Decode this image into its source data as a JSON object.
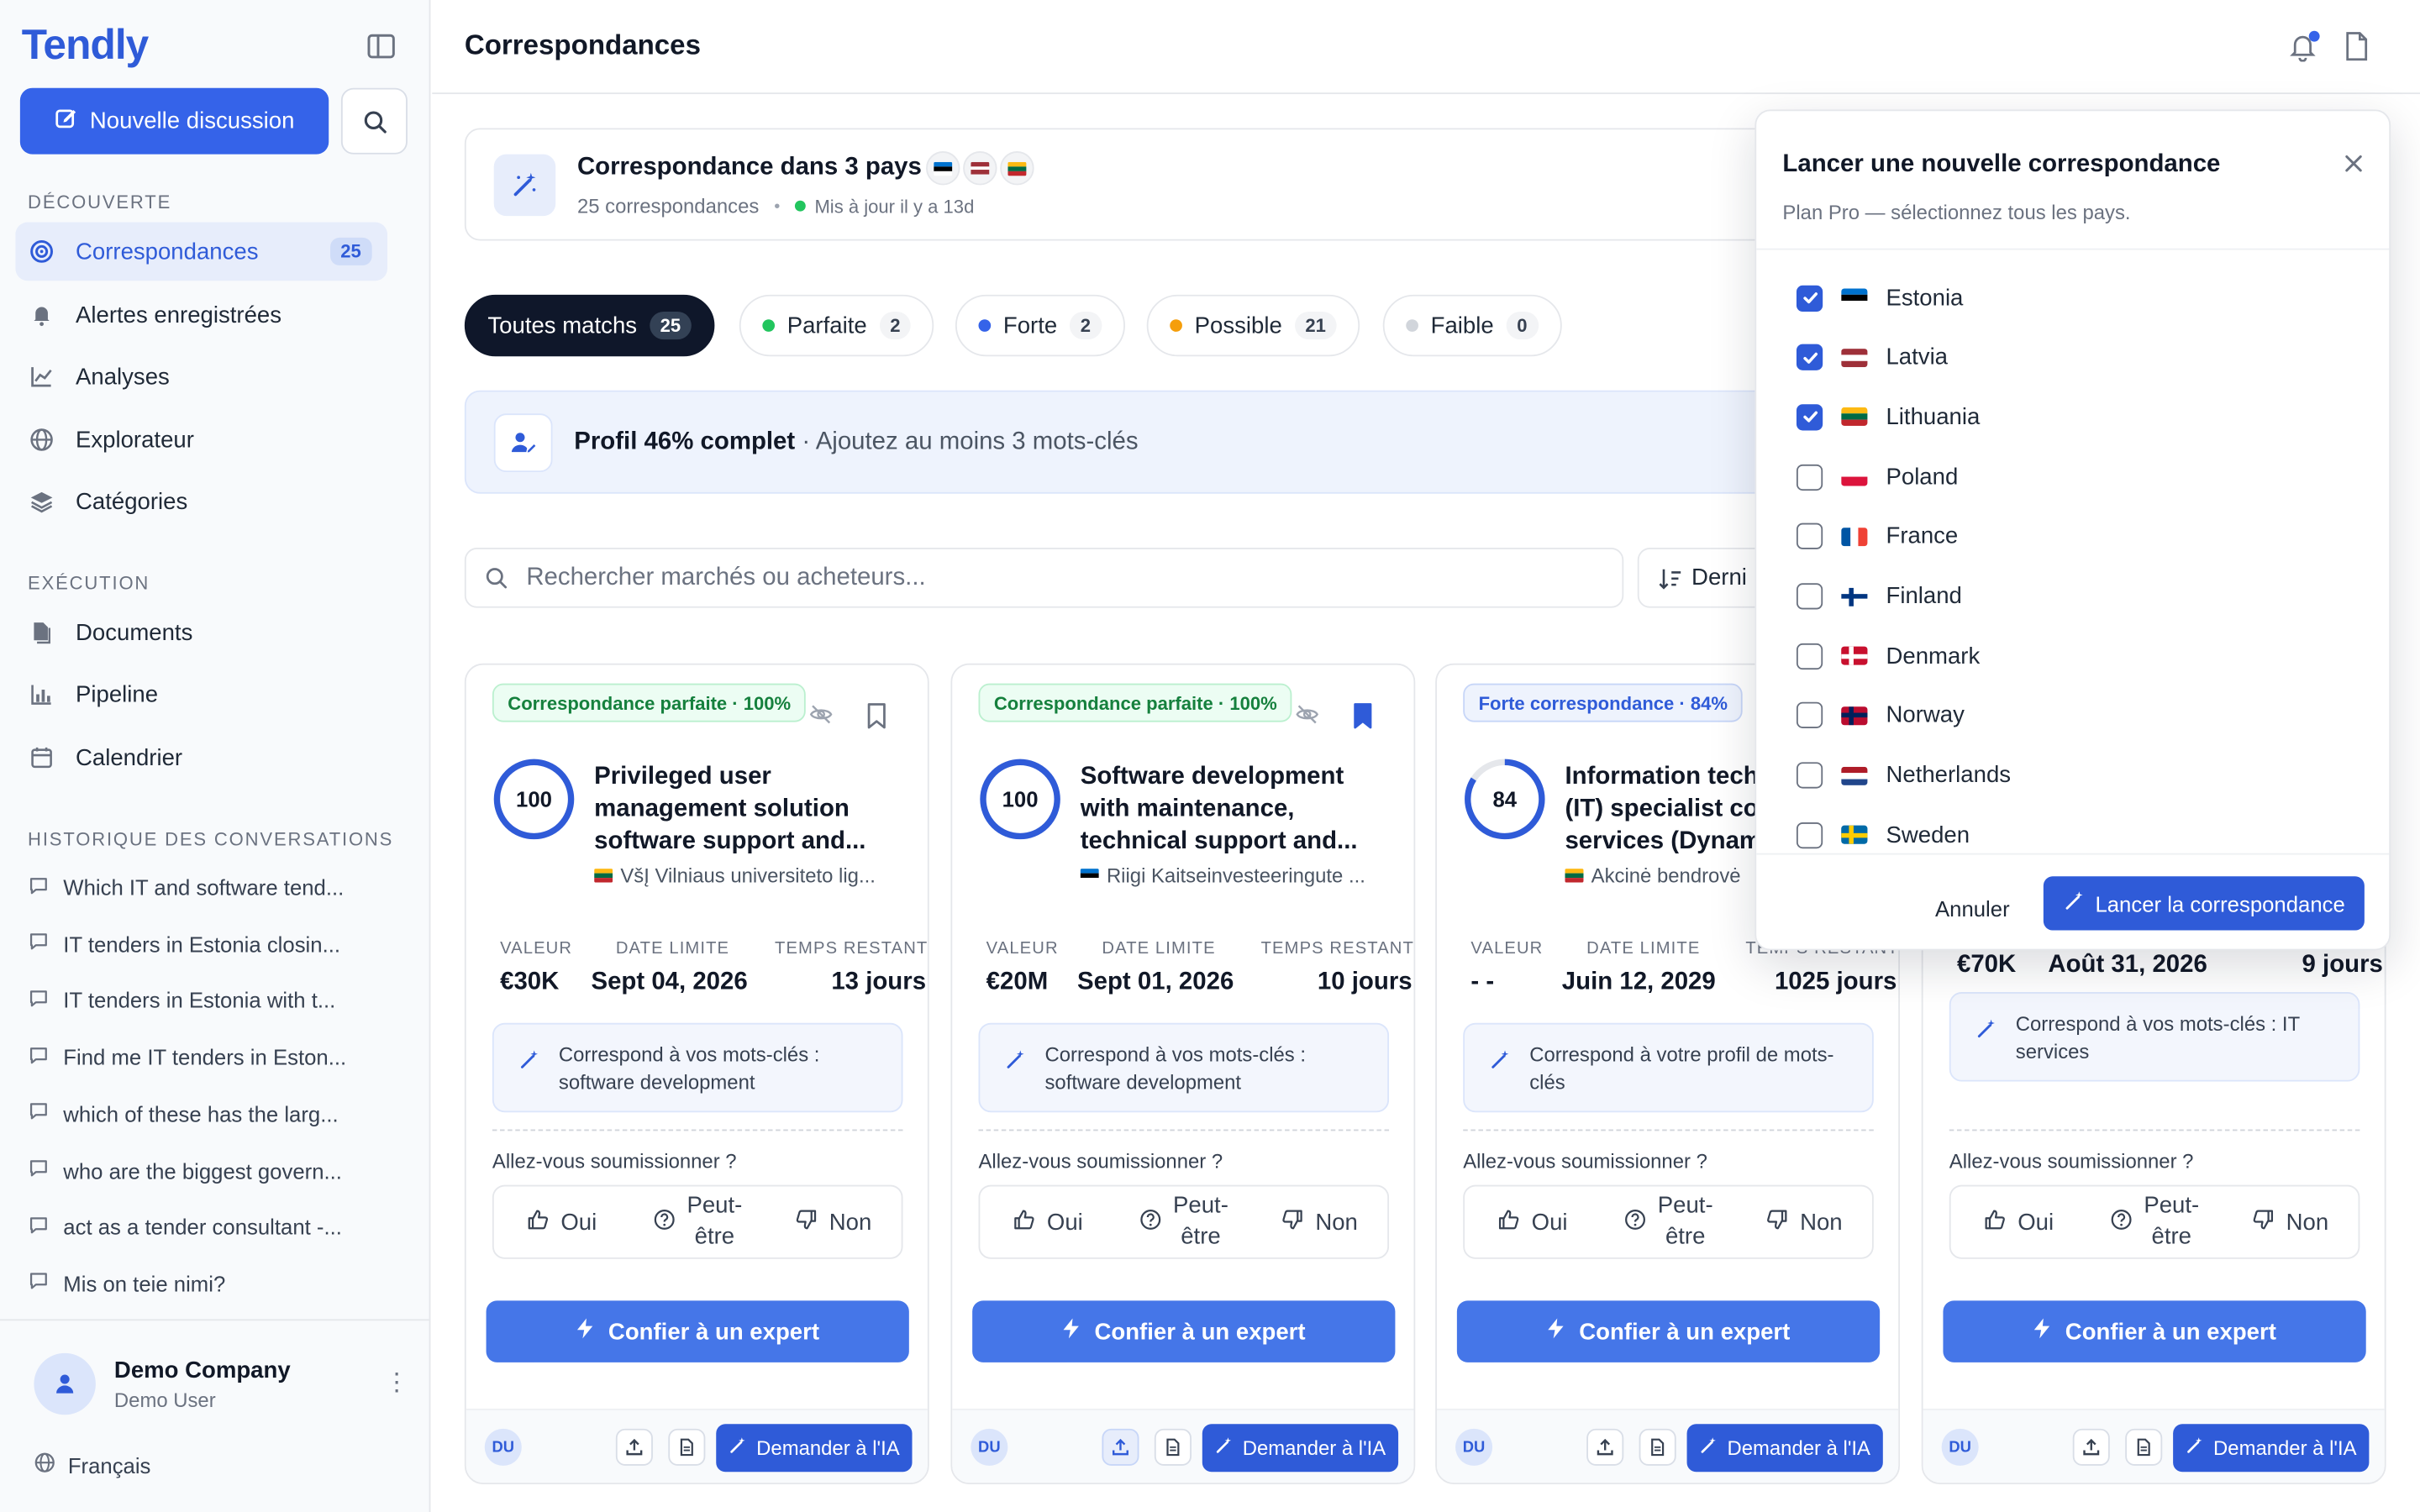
{
  "app": {
    "brand": "Tendly",
    "new_chat": "Nouvelle discussion"
  },
  "sidebar": {
    "sections": {
      "discovery": "DÉCOUVERTE",
      "execution": "EXÉCUTION",
      "history": "HISTORIQUE DES CONVERSATIONS"
    },
    "discovery_items": [
      {
        "label": "Correspondances",
        "count": "25",
        "icon": "target-icon",
        "active": true
      },
      {
        "label": "Alertes enregistrées",
        "icon": "bell-icon"
      },
      {
        "label": "Analyses",
        "icon": "chart-line-icon"
      },
      {
        "label": "Explorateur",
        "icon": "globe-icon"
      },
      {
        "label": "Catégories",
        "icon": "layers-icon"
      }
    ],
    "execution_items": [
      {
        "label": "Documents",
        "icon": "files-icon"
      },
      {
        "label": "Pipeline",
        "icon": "bar-chart-icon"
      },
      {
        "label": "Calendrier",
        "icon": "calendar-icon"
      }
    ],
    "history_items": [
      "Which IT and software tend...",
      "IT tenders in Estonia closin...",
      "IT tenders in Estonia with t...",
      "Find me IT tenders in Eston...",
      "which of these has the larg...",
      "who are the biggest govern...",
      "act as a tender consultant -...",
      "Mis on teie nimi?"
    ],
    "footer": {
      "company": "Demo Company",
      "user": "Demo User",
      "language": "Français"
    }
  },
  "header": {
    "title": "Correspondances"
  },
  "banner": {
    "title": "Correspondance dans 3 pays",
    "count_text": "25 correspondances",
    "updated": "Mis à jour il y a 13d"
  },
  "filters": [
    {
      "label": "Toutes matchs",
      "count": "25",
      "active": true
    },
    {
      "label": "Parfaite",
      "count": "2",
      "dot": "#22c55e"
    },
    {
      "label": "Forte",
      "count": "2",
      "dot": "#3563e9"
    },
    {
      "label": "Possible",
      "count": "21",
      "dot": "#f59e0b"
    },
    {
      "label": "Faible",
      "count": "0",
      "dot": "#d1d5db"
    }
  ],
  "profile": {
    "strong": "Profil 46% complet",
    "rest": " · Ajoutez au moins 3 mots-clés"
  },
  "search": {
    "placeholder": "Rechercher marchés ou acheteurs...",
    "sort_label": "Derni"
  },
  "stat_labels": {
    "value": "VALEUR",
    "deadline": "DATE LIMITE",
    "remaining": "TEMPS RESTANT"
  },
  "card_common": {
    "bid_question": "Allez-vous soumissionner ?",
    "yes": "Oui",
    "maybe_1": "Peut-",
    "maybe_2": "être",
    "no": "Non",
    "expert": "Confier à un expert",
    "ask_ai": "Demander à l'IA",
    "initials": "DU"
  },
  "cards": [
    {
      "badge": "Correspondance parfaite · 100%",
      "kind": "perfect",
      "score": "100",
      "title": "Privileged user management solution software support and...",
      "buyer": "VšĮ Vilniaus universiteto lig...",
      "flag": "lithuania",
      "value": "€30K",
      "deadline": "Sept 04, 2026",
      "remaining": "13 jours",
      "kw": "Correspond à vos mots-clés : software development",
      "bookmarked": false
    },
    {
      "badge": "Correspondance parfaite · 100%",
      "kind": "perfect",
      "score": "100",
      "title": "Software development with maintenance, technical support and...",
      "buyer": "Riigi Kaitseinvesteeringute ...",
      "flag": "estonia",
      "value": "€20M",
      "deadline": "Sept 01, 2026",
      "remaining": "10 jours",
      "kw": "Correspond à vos mots-clés : software development",
      "bookmarked": true
    },
    {
      "badge": "Forte correspondance · 84%",
      "kind": "strong",
      "score": "84",
      "title": "Information technology (IT) specialist consulting services (Dynamics...",
      "buyer": "Akcinė bendrovė",
      "flag": "lithuania",
      "value": "- -",
      "deadline": "Juin 12, 2029",
      "remaining": "1025 jours",
      "kw": "Correspond à votre profil de mots-clés",
      "bookmarked": false
    },
    {
      "badge": "",
      "kind": "possible",
      "score": "",
      "title": "",
      "buyer": "",
      "flag": "",
      "value": "€70K",
      "deadline": "Août 31, 2026",
      "remaining": "9 jours",
      "kw": "Correspond à vos mots-clés : IT services",
      "bookmarked": false
    }
  ],
  "modal": {
    "title": "Lancer une nouvelle correspondance",
    "subtitle": "Plan Pro — sélectionnez tous les pays.",
    "countries": [
      {
        "name": "Estonia",
        "checked": true
      },
      {
        "name": "Latvia",
        "checked": true
      },
      {
        "name": "Lithuania",
        "checked": true
      },
      {
        "name": "Poland",
        "checked": false
      },
      {
        "name": "France",
        "checked": false
      },
      {
        "name": "Finland",
        "checked": false
      },
      {
        "name": "Denmark",
        "checked": false
      },
      {
        "name": "Norway",
        "checked": false
      },
      {
        "name": "Netherlands",
        "checked": false
      },
      {
        "name": "Sweden",
        "checked": false
      }
    ],
    "cancel": "Annuler",
    "launch": "Lancer la correspondance"
  },
  "colors": {
    "accent": "#2f5bd8",
    "perfect": "#15803d",
    "score_ring": "#2f5bd8"
  }
}
